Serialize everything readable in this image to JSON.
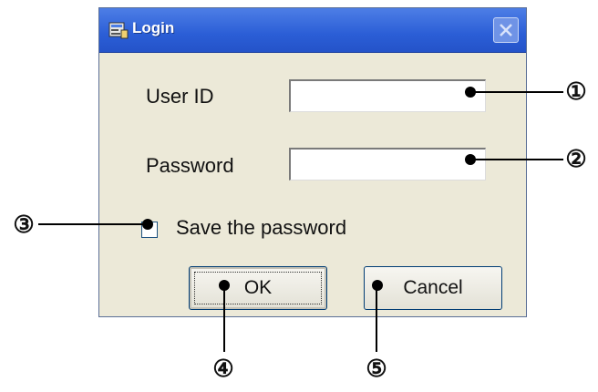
{
  "window": {
    "title": "Login",
    "icon": "login-window-icon",
    "close_icon": "close-icon"
  },
  "form": {
    "user_id_label": "User ID",
    "user_id_value": "",
    "password_label": "Password",
    "password_value": "",
    "save_password_label": "Save the password",
    "save_password_checked": false
  },
  "buttons": {
    "ok_label": "OK",
    "cancel_label": "Cancel"
  },
  "callouts": [
    "①",
    "②",
    "③",
    "④",
    "⑤"
  ],
  "colors": {
    "titlebar": "#2b5ed6",
    "dialog_bg": "#ece9d8",
    "button_border": "#003c74"
  }
}
